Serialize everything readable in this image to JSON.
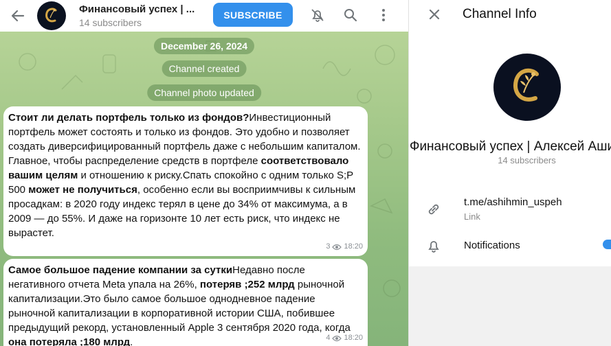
{
  "header": {
    "channel_title": "Финансовый успех | ...",
    "subscribers": "14 subscribers",
    "subscribe_label": "SUBSCRIBE"
  },
  "timeline": {
    "date": "December 26, 2024",
    "service_created": "Channel created",
    "service_photo": "Channel photo updated"
  },
  "messages": [
    {
      "parts": [
        {
          "t": "Стоит ли делать портфель только из фондов?",
          "b": true
        },
        {
          "t": "Инвестиционный портфель может состоять и только из фондов. Это удобно и позволяет создать диверсифицированный портфель даже с небольшим капиталом. Главное, чтобы распределение средств в портфеле ",
          "b": false
        },
        {
          "t": "соответствовало вашим целям",
          "b": true
        },
        {
          "t": " и отношению к риску.Спать спокойно с одним только S;P 500 ",
          "b": false
        },
        {
          "t": "может не получиться",
          "b": true
        },
        {
          "t": ", особенно если вы восприимчивы к сильным просадкам: в 2020 году индекс терял в цене до 34% от максимума, а в 2009 — до 55%. И даже на горизонте 10 лет есть риск, что индекс не вырастет.",
          "b": false
        }
      ],
      "views": "3",
      "time": "18:20"
    },
    {
      "parts": [
        {
          "t": "Самое большое падение компании за сутки",
          "b": true
        },
        {
          "t": "Недавно после негативного отчета Meta упала на 26%, ",
          "b": false
        },
        {
          "t": "потеряв ;252 млрд",
          "b": true
        },
        {
          "t": " рыночной капитализации.Это было самое большое однодневное падение рыночной капитализации в корпоративной истории США, побившее предыдущий рекорд, установленный Apple 3 сентября 2020 года, когда ",
          "b": false
        },
        {
          "t": "она потеряла ;180 млрд",
          "b": true
        },
        {
          "t": ".",
          "b": false
        }
      ],
      "views": "4",
      "time": "18:20"
    }
  ],
  "info": {
    "title": "Channel Info",
    "name": "Финансовый успех | Алексей Ашихмин",
    "subscribers": "14 subscribers",
    "link": "t.me/ashihmin_uspeh",
    "link_caption": "Link",
    "notifications_label": "Notifications",
    "notifications_on": true
  },
  "colors": {
    "accent": "#3390ec",
    "avatar_bg": "#0b1220",
    "avatar_gold": "#d4a645"
  },
  "icons": [
    "arrow-back-icon",
    "bell-off-icon",
    "search-icon",
    "more-vertical-icon",
    "close-icon",
    "link-icon",
    "bell-icon",
    "eye-icon",
    "channel-logo-icon"
  ]
}
